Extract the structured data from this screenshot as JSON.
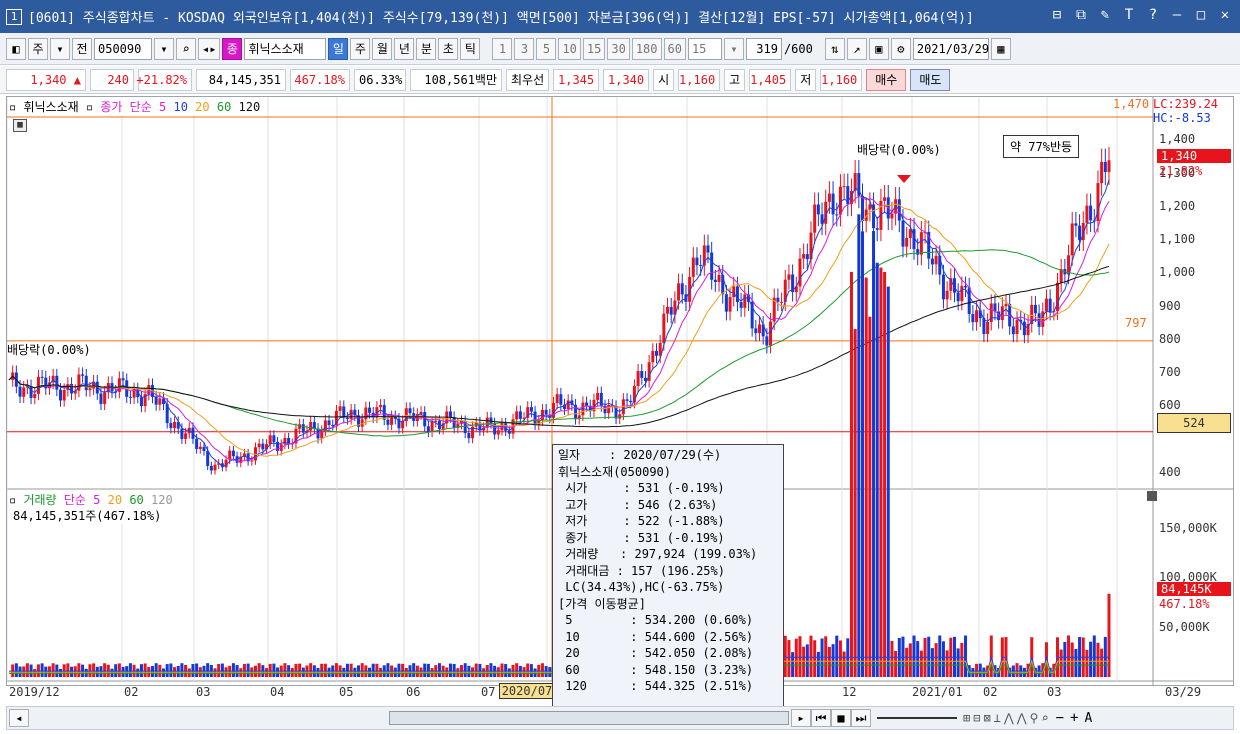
{
  "window": {
    "number": "1",
    "title": "[0601] 주식종합차트 - KOSDAQ 외국인보유[1,404(천)] 주식수[79,139(천)] 액면[500] 자본금[396(억)] 결산[12월] EPS[-57] 시가총액[1,064(억)]",
    "controls": [
      "⊟",
      "⧉",
      "✎",
      "T",
      "?",
      "—",
      "□",
      "✕"
    ]
  },
  "toolbar": {
    "market_select": "주",
    "prev_label": "전",
    "code": "050090",
    "stock_name": "휘닉스소재",
    "stock_badge": "종",
    "periods": [
      "일",
      "주",
      "월",
      "년",
      "분",
      "초",
      "틱"
    ],
    "active_period": "일",
    "intervals": [
      "1",
      "3",
      "5",
      "10",
      "15",
      "30",
      "180",
      "60"
    ],
    "interval_value": "15",
    "count": "319",
    "count_max": "/600",
    "date": "2021/03/29"
  },
  "quote": {
    "price": "1,340",
    "change_arrow": "▲",
    "change": "240",
    "change_pct": "+21.82%",
    "volume": "84,145,351",
    "volume_ratio": "467.18%",
    "turnover": "06.33%",
    "amount": "108,561백만",
    "best_label": "최우선",
    "best_ask": "1,345",
    "best_bid": "1,340",
    "open_label": "시",
    "open": "1,160",
    "high_label": "고",
    "high": "1,405",
    "low_label": "저",
    "low": "1,160",
    "buy_label": "매수",
    "sell_label": "매도"
  },
  "price_panel": {
    "stock_label": "휘닉스소재",
    "ma_label": "종가 단순",
    "ma_periods": [
      "5",
      "10",
      "20",
      "60",
      "120"
    ],
    "top_label": "1,470",
    "lc_label": "LC:239.24",
    "hc_label": "HC:-8.53",
    "current_price_label": "1,340",
    "current_pct_label": "21.82%",
    "line_797": "797",
    "cursor_price": "524",
    "annotation_dividend_top": "배당락(0.00%)",
    "annotation_dividend_left": "배당락(0.00%)",
    "annotation_rebound": "약 77%반등",
    "y_ticks": [
      "1,400",
      "1,300",
      "1,200",
      "1,100",
      "1,000",
      "900",
      "800",
      "700",
      "600",
      "400"
    ]
  },
  "volume_panel": {
    "label": "거래량",
    "ma_label": "단순",
    "ma_periods": [
      "5",
      "20",
      "60",
      "120"
    ],
    "value_line": "84,145,351주(467.18%)",
    "y_ticks": [
      "150,000K",
      "100,000K",
      "50,000K"
    ],
    "current_vol_label": "84,145K",
    "current_vol_pct": "467.18%"
  },
  "x_axis": {
    "ticks": [
      "2019/12",
      "02",
      "03",
      "04",
      "05",
      "06",
      "07",
      "12",
      "2021/01",
      "02",
      "03"
    ],
    "cursor_date": "2020/07",
    "right_label": "03/29"
  },
  "tooltip": {
    "lines": [
      "일자    : 2020/07/29(수)",
      "휘닉스소재(050090)",
      " 시가     : 531 (-0.19%)",
      " 고가     : 546 (2.63%)",
      " 저가     : 522 (-1.88%)",
      " 종가     : 531 (-0.19%)",
      " 거래량   : 297,924 (199.03%)",
      " 거래대금 : 157 (196.25%)",
      " LC(34.43%),HC(-63.75%)",
      "[가격 이동평균]",
      " 5        : 534.200 (0.60%)",
      " 10       : 544.600 (2.56%)",
      " 20       : 542.050 (2.08%)",
      " 60       : 548.150 (3.23%)",
      " 120      : 544.325 (2.51%)"
    ]
  },
  "colors": {
    "up": "#e8141c",
    "down": "#1438d8",
    "ma5": "#1f3fe0",
    "ma10": "#d81ed8",
    "ma20": "#f0a018",
    "ma60": "#1c9a2c",
    "ma120": "#111111",
    "guide": "#f07020"
  },
  "chart_data": {
    "type": "candlestick",
    "y_range": [
      370,
      1470
    ],
    "reference_lines": {
      "orange": [
        1470,
        797
      ],
      "red": [
        524
      ]
    },
    "candles_approx_close": [
      [
        "2019/12",
        660
      ],
      [
        "2020/01",
        660
      ],
      [
        "2020/02",
        640
      ],
      [
        "2020/03",
        420
      ],
      [
        "2020/04",
        500
      ],
      [
        "2020/05",
        580
      ],
      [
        "2020/06",
        560
      ],
      [
        "2020/07",
        531
      ],
      [
        "2020/08",
        600
      ],
      [
        "2020/09",
        600
      ],
      [
        "2020/10",
        1050
      ],
      [
        "2020/11",
        820
      ],
      [
        "2020/12",
        1250
      ],
      [
        "2021/01",
        1150
      ],
      [
        "2021/02",
        880
      ],
      [
        "2021/03",
        850
      ],
      [
        "2021/03/29",
        1340
      ]
    ],
    "volume_peaks_k": [
      [
        "2020/12",
        170000
      ],
      [
        "2021/01",
        150000
      ],
      [
        "2021/03/29",
        84145
      ]
    ]
  }
}
